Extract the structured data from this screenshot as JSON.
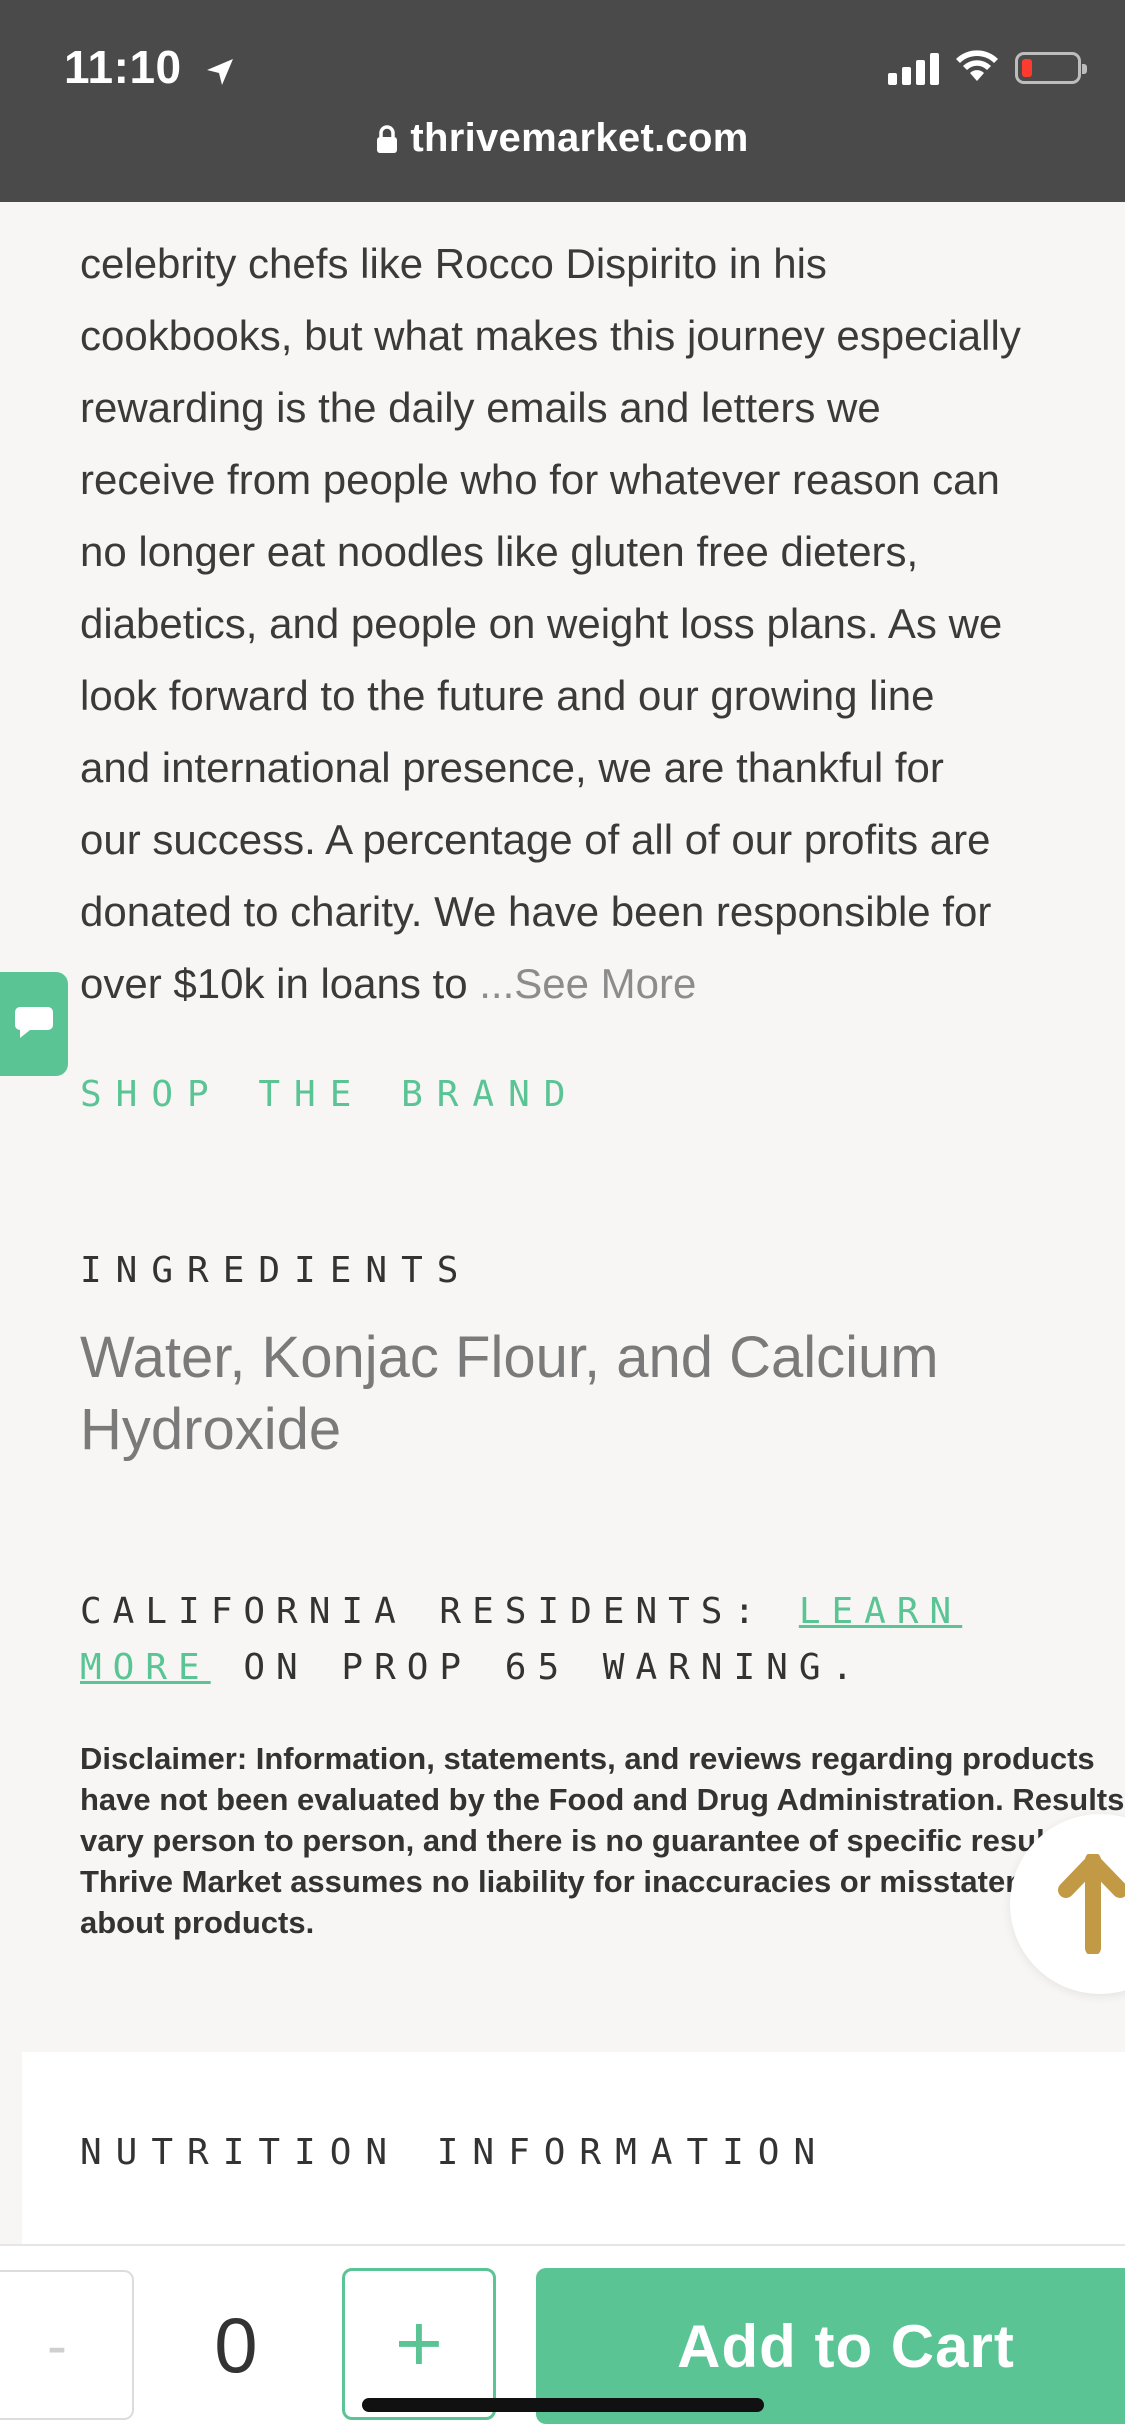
{
  "status_bar": {
    "time": "11:10",
    "location_icon": "location-arrow-icon",
    "signal_icon": "cellular-signal-icon",
    "wifi_icon": "wifi-icon",
    "battery_icon": "battery-low-icon",
    "battery_color": "#ff3b30"
  },
  "browser": {
    "url": "thrivemarket.com",
    "lock_icon": "lock-icon"
  },
  "brand_description": {
    "text": "celebrity chefs like Rocco Dispirito in his\ncookbooks, but what makes this journey especially\nrewarding is the daily emails and letters we\nreceive from people who for whatever reason can\nno longer eat noodles like gluten free dieters,\ndiabetics, and people on weight loss plans. As we\nlook forward to the future and our growing line\nand international presence, we are thankful for\nour success. A percentage of all of our profits are\ndonated to charity. We have been responsible for\nover $10k in loans to ",
    "see_more": "...See More"
  },
  "shop_the_brand": "SHOP THE BRAND",
  "ingredients": {
    "title": "INGREDIENTS",
    "text": "Water, Konjac Flour, and Calcium Hydroxide"
  },
  "prop65": {
    "prefix": "CALIFORNIA RESIDENTS: ",
    "link": "LEARN MORE",
    "suffix": " ON PROP 65 WARNING."
  },
  "disclaimer": "Disclaimer: Information, statements, and reviews regarding products have not been evaluated by the Food and Drug Administration. Results vary person to person, and there is no guarantee of specific results. Thrive Market assumes no liability for inaccuracies or misstatements about products.",
  "nutrition": {
    "title": "NUTRITION INFORMATION"
  },
  "cart": {
    "minus_label": "-",
    "quantity": "0",
    "plus_label": "+",
    "add_label": "Add to Cart"
  },
  "colors": {
    "accent": "#5bc495",
    "header_bg": "#4a4a4a",
    "page_bg": "#f7f6f4",
    "scroll_top_arrow": "#c29a45"
  }
}
